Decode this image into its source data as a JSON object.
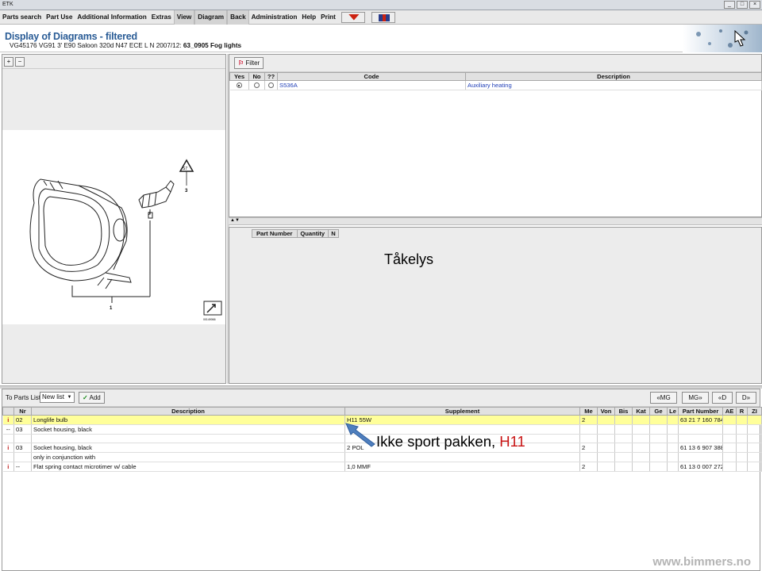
{
  "window": {
    "app_title": "ETK"
  },
  "menu": [
    "Parts search",
    "Part Use",
    "Additional Information",
    "Extras",
    "View",
    "Diagram",
    "Back",
    "Administration",
    "Help",
    "Print"
  ],
  "header": {
    "title": "Display of Diagrams - filtered",
    "subtitle_prefix": "VG45176 VG91 3' E90 Saloon 320d N47 ECE L N 2007/12:",
    "subtitle_bold": "63_0905 Fog lights"
  },
  "filter": {
    "button_label": "Filter",
    "columns": [
      "Yes",
      "No",
      "??",
      "Code",
      "Description"
    ],
    "rows": [
      {
        "yes": true,
        "no": false,
        "unknown": false,
        "code": "S536A",
        "description": "Auxiliary heating"
      }
    ]
  },
  "parts_header": {
    "columns": [
      "Part Number",
      "Quantity",
      "N"
    ]
  },
  "overlay_note": "Tåkelys",
  "diagram": {
    "callout_1": "1",
    "callout_2": "2",
    "callout_3": "3",
    "ref_number": "00149066"
  },
  "bottom": {
    "to_parts_list_label": "To Parts List",
    "list_select_value": "New list",
    "add_button": "Add",
    "nav_buttons": [
      "«MG",
      "MG»",
      "«D",
      "D»"
    ],
    "columns": [
      "",
      "Nr",
      "Description",
      "Supplement",
      "Me",
      "Von",
      "Bis",
      "Kat",
      "Ge",
      "Le",
      "Part Number",
      "AE",
      "R",
      "ZI"
    ],
    "rows": [
      {
        "icon": "i",
        "nr": "02",
        "description": "Longlife bulb",
        "supplement": "H11 55W",
        "me": "2",
        "part": "63 21 7 160 784",
        "highlight": true
      },
      {
        "icon": "--",
        "nr": "03",
        "description": "Socket housing, black",
        "supplement": "",
        "me": "",
        "part": "",
        "highlight": false
      },
      {
        "icon": "",
        "nr": "",
        "description": "",
        "supplement": "",
        "me": "",
        "part": "",
        "highlight": false
      },
      {
        "icon": "i",
        "nr": "03",
        "description": "Socket housing, black",
        "supplement": "2 POL",
        "me": "2",
        "part": "61 13 6 907 388",
        "highlight": false
      },
      {
        "icon": "",
        "nr": "",
        "description": "only in conjunction with",
        "supplement": "",
        "me": "",
        "part": "",
        "highlight": false
      },
      {
        "icon": "i",
        "nr": "--",
        "description": "Flat spring contact microtimer w/ cable",
        "supplement": "1,0 MMF",
        "me": "2",
        "part": "61 13 0 007 272",
        "highlight": false
      }
    ]
  },
  "annotation": {
    "text": "Ikke sport pakken, ",
    "red_text": "H11"
  },
  "watermark": "www.bimmers.no",
  "colors": {
    "title_blue": "#2a5c96",
    "highlight_yellow": "#ffff9a",
    "link_blue": "#2241b8",
    "annotation_red": "#c81414"
  }
}
